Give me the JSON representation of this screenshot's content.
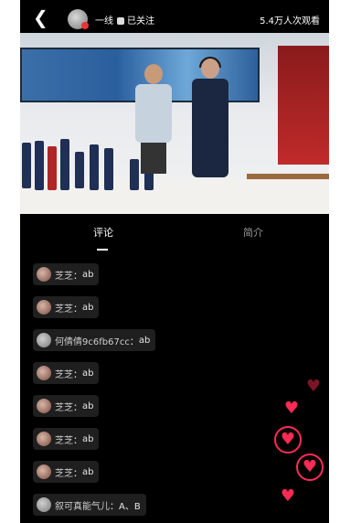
{
  "header": {
    "back_icon": "back-chevron-icon",
    "channel_name": "一线",
    "follow_status": "已关注",
    "viewers": "5.4万人次观看"
  },
  "tabs": [
    {
      "label": "评论",
      "active": true
    },
    {
      "label": "简介",
      "active": false
    }
  ],
  "comments": [
    {
      "user": "芝芝",
      "text": "ab"
    },
    {
      "user": "芝芝",
      "text": "ab"
    },
    {
      "user": "何倩倩9c6fb67cc",
      "text": "ab"
    },
    {
      "user": "芝芝",
      "text": "ab"
    },
    {
      "user": "芝芝",
      "text": "ab"
    },
    {
      "user": "芝芝",
      "text": "ab"
    },
    {
      "user": "芝芝",
      "text": "ab"
    },
    {
      "user": "叙可真能气儿",
      "text": "A、B"
    }
  ],
  "colors": {
    "background": "#000000",
    "heart": "#ff2b55",
    "comment_bg": "#1f1f1f"
  }
}
